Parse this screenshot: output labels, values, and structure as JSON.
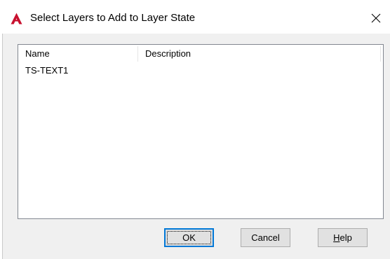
{
  "window": {
    "title": "Select Layers to Add to Layer State",
    "app_icon": "autocad-logo-icon",
    "close_icon": "close-icon"
  },
  "list": {
    "columns": [
      "Name",
      "Description"
    ],
    "rows": [
      {
        "name": "TS-TEXT1",
        "description": ""
      }
    ]
  },
  "buttons": {
    "ok_label": "OK",
    "cancel_label": "Cancel",
    "help_mnemonic": "H",
    "help_rest": "elp"
  },
  "colors": {
    "app_icon_red": "#c8102e",
    "ok_border_accent": "#0078d7",
    "dialog_background": "#f0f0f0"
  }
}
